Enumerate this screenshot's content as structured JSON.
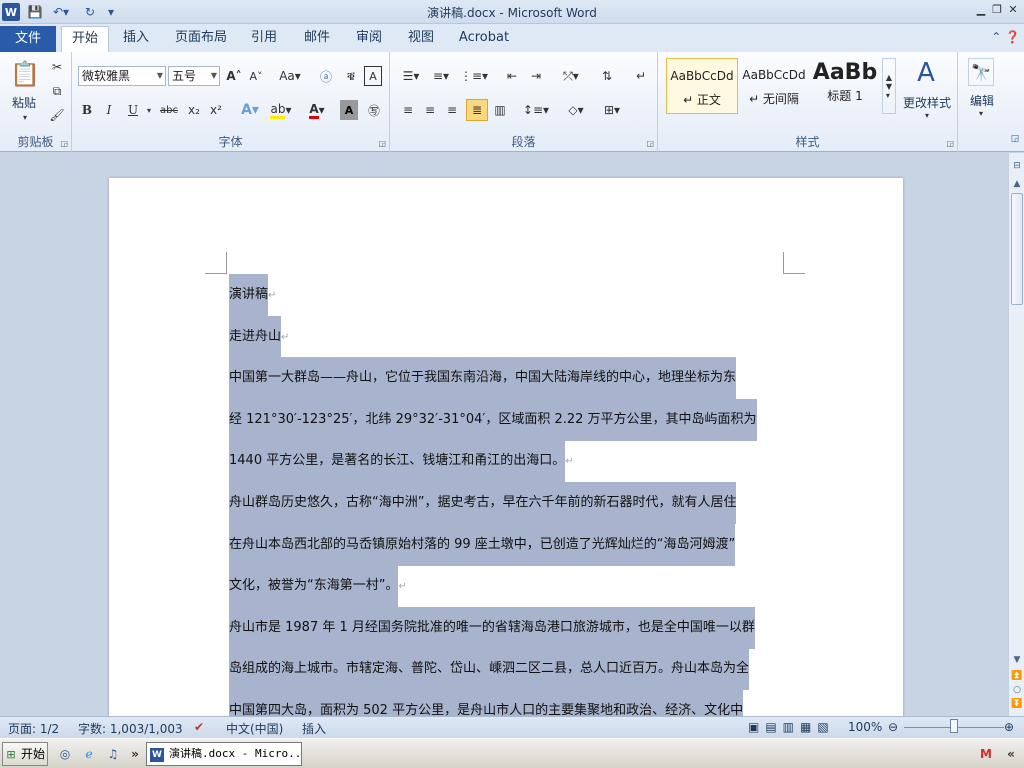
{
  "window": {
    "title": "演讲稿.docx - Microsoft Word",
    "app_icon": "W"
  },
  "tabs": {
    "file": "文件",
    "items": [
      "开始",
      "插入",
      "页面布局",
      "引用",
      "邮件",
      "审阅",
      "视图",
      "Acrobat"
    ]
  },
  "ribbon": {
    "clipboard": {
      "paste": "粘贴",
      "label": "剪贴板"
    },
    "font": {
      "name": "微软雅黑",
      "size": "五号",
      "label": "字体",
      "bold": "B",
      "italic": "I",
      "underline": "U",
      "strike": "abc",
      "sub": "x₂",
      "sup": "x²",
      "grow": "A",
      "shrink": "A",
      "case": "Aa"
    },
    "paragraph": {
      "label": "段落"
    },
    "styles": {
      "label": "样式",
      "items": [
        {
          "sample": "AaBbCcDd",
          "name": "↵ 正文"
        },
        {
          "sample": "AaBbCcDd",
          "name": "↵ 无间隔"
        },
        {
          "sample": "AaBb",
          "name": "标题 1"
        }
      ],
      "change": "更改样式"
    },
    "editing": {
      "label": "编辑"
    }
  },
  "document": {
    "lines": [
      "演讲稿",
      "走进舟山",
      "中国第一大群岛——舟山，它位于我国东南沿海，中国大陆海岸线的中心，地理坐标为东",
      "经 121°30′-123°25′，北纬 29°32′-31°04′，区域面积 2.22 万平方公里，其中岛屿面积为",
      "1440 平方公里，是著名的长江、钱塘江和甬江的出海口。",
      "舟山群岛历史悠久，古称“海中洲”，据史考古，早在六千年前的新石器时代，就有人居住",
      "在舟山本岛西北部的马岙镇原始村落的 99 座土墩中，已创造了光辉灿烂的“海岛河姆渡”",
      "文化，被誉为“东海第一村”。",
      "舟山市是 1987 年 1 月经国务院批准的唯一的省辖海岛港口旅游城市，也是全中国唯一以群",
      "岛组成的海上城市。市辖定海、普陀、岱山、嵊泗二区二县，总人口近百万。舟山本岛为全",
      "中国第四大岛，面积为 502 平方公里，是舟山市人口的主要集聚地和政治、经济、文化中"
    ],
    "para_end_lines": [
      0,
      1,
      4,
      7
    ]
  },
  "status": {
    "page": "页面: 1/2",
    "words": "字数: 1,003/1,003",
    "language": "中文(中国)",
    "mode": "插入",
    "zoom": "100%"
  },
  "taskbar": {
    "start": "开始",
    "task": "演讲稿.docx - Micro..."
  }
}
